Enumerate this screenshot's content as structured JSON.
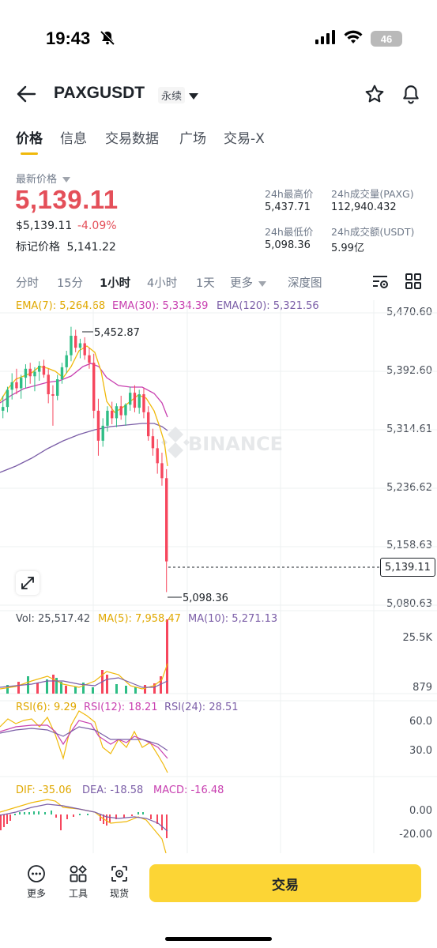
{
  "status": {
    "time": "19:43",
    "battery": "46"
  },
  "header": {
    "symbol": "PAXGUSDT",
    "contract": "永续"
  },
  "tabs": [
    "价格",
    "信息",
    "交易数据",
    "广场",
    "交易-X"
  ],
  "price": {
    "label": "最新价格",
    "last": "5,139.11",
    "usd": "$5,139.11",
    "change": "-4.09%",
    "mark_label": "标记价格",
    "mark": "5,141.22"
  },
  "stats": {
    "high_label": "24h最高价",
    "high": "5,437.71",
    "low_label": "24h最低价",
    "low": "5,098.36",
    "vol_label": "24h成交量(PAXG)",
    "vol": "112,940.432",
    "amt_label": "24h成交额(USDT)",
    "amt": "5.99亿"
  },
  "intervals": [
    "分时",
    "15分",
    "1小时",
    "4小时",
    "1天",
    "更多",
    "深度图"
  ],
  "active_interval": "1小时",
  "ema": {
    "ema7": "EMA(7): 5,264.68",
    "ema30": "EMA(30): 5,334.39",
    "ema120": "EMA(120): 5,321.56"
  },
  "price_axis": [
    "5,470.60",
    "5,392.60",
    "5,314.61",
    "5,236.62",
    "5,158.63",
    "5,080.63"
  ],
  "current_price_tag": "5,139.11",
  "annotations": {
    "high": "5,452.87",
    "low": "5,098.36"
  },
  "watermark": "BINANCE",
  "volume": {
    "vol": "Vol: 25,517.42",
    "ma5": "MA(5): 7,958.47",
    "ma10": "MA(10): 5,271.13",
    "axis_top": "25.5K",
    "axis_bottom": "879"
  },
  "rsi": {
    "rsi6": "RSI(6): 9.29",
    "rsi12": "RSI(12): 18.21",
    "rsi24": "RSI(24): 28.51",
    "axis_top": "60.0",
    "axis_bottom": "30.0"
  },
  "macd": {
    "dif": "DIF: -35.06",
    "dea": "DEA: -18.58",
    "macd": "MACD: -16.48",
    "axis_top": "0.00",
    "axis_bottom": "-20.00"
  },
  "bottom": {
    "more": "更多",
    "tools": "工具",
    "spot": "现货",
    "trade": "交易"
  },
  "colors": {
    "up": "#2ebd85",
    "down": "#f6465d",
    "accent": "#f0b90b",
    "ema7": "#f0b90b",
    "ema30": "#c840b0",
    "ema120": "#7b5ea7"
  },
  "chart_data": {
    "type": "candlestick",
    "price_range": [
      5080.63,
      5470.6
    ],
    "candles": [
      {
        "o": 5340,
        "h": 5360,
        "l": 5330,
        "c": 5345
      },
      {
        "o": 5345,
        "h": 5372,
        "l": 5338,
        "c": 5368
      },
      {
        "o": 5368,
        "h": 5390,
        "l": 5355,
        "c": 5378
      },
      {
        "o": 5378,
        "h": 5396,
        "l": 5362,
        "c": 5370
      },
      {
        "o": 5370,
        "h": 5388,
        "l": 5356,
        "c": 5384
      },
      {
        "o": 5384,
        "h": 5402,
        "l": 5370,
        "c": 5396
      },
      {
        "o": 5396,
        "h": 5404,
        "l": 5376,
        "c": 5386
      },
      {
        "o": 5386,
        "h": 5398,
        "l": 5366,
        "c": 5392
      },
      {
        "o": 5392,
        "h": 5406,
        "l": 5380,
        "c": 5400
      },
      {
        "o": 5400,
        "h": 5408,
        "l": 5384,
        "c": 5388
      },
      {
        "o": 5388,
        "h": 5396,
        "l": 5350,
        "c": 5362
      },
      {
        "o": 5362,
        "h": 5374,
        "l": 5320,
        "c": 5360
      },
      {
        "o": 5360,
        "h": 5388,
        "l": 5354,
        "c": 5382
      },
      {
        "o": 5382,
        "h": 5404,
        "l": 5376,
        "c": 5398
      },
      {
        "o": 5398,
        "h": 5420,
        "l": 5390,
        "c": 5414
      },
      {
        "o": 5414,
        "h": 5452,
        "l": 5406,
        "c": 5440
      },
      {
        "o": 5440,
        "h": 5448,
        "l": 5418,
        "c": 5424
      },
      {
        "o": 5424,
        "h": 5436,
        "l": 5410,
        "c": 5430
      },
      {
        "o": 5430,
        "h": 5438,
        "l": 5408,
        "c": 5414
      },
      {
        "o": 5414,
        "h": 5424,
        "l": 5396,
        "c": 5404
      },
      {
        "o": 5404,
        "h": 5416,
        "l": 5330,
        "c": 5340
      },
      {
        "o": 5340,
        "h": 5356,
        "l": 5280,
        "c": 5300
      },
      {
        "o": 5300,
        "h": 5330,
        "l": 5292,
        "c": 5320
      },
      {
        "o": 5320,
        "h": 5346,
        "l": 5312,
        "c": 5340
      },
      {
        "o": 5340,
        "h": 5352,
        "l": 5322,
        "c": 5330
      },
      {
        "o": 5330,
        "h": 5350,
        "l": 5318,
        "c": 5346
      },
      {
        "o": 5346,
        "h": 5360,
        "l": 5328,
        "c": 5334
      },
      {
        "o": 5334,
        "h": 5350,
        "l": 5320,
        "c": 5348
      },
      {
        "o": 5348,
        "h": 5372,
        "l": 5340,
        "c": 5364
      },
      {
        "o": 5364,
        "h": 5374,
        "l": 5338,
        "c": 5344
      },
      {
        "o": 5344,
        "h": 5368,
        "l": 5336,
        "c": 5362
      },
      {
        "o": 5362,
        "h": 5370,
        "l": 5330,
        "c": 5338
      },
      {
        "o": 5338,
        "h": 5346,
        "l": 5300,
        "c": 5306
      },
      {
        "o": 5306,
        "h": 5316,
        "l": 5280,
        "c": 5290
      },
      {
        "o": 5290,
        "h": 5302,
        "l": 5256,
        "c": 5270
      },
      {
        "o": 5270,
        "h": 5284,
        "l": 5240,
        "c": 5250
      },
      {
        "o": 5250,
        "h": 5262,
        "l": 5098,
        "c": 5139
      }
    ]
  }
}
